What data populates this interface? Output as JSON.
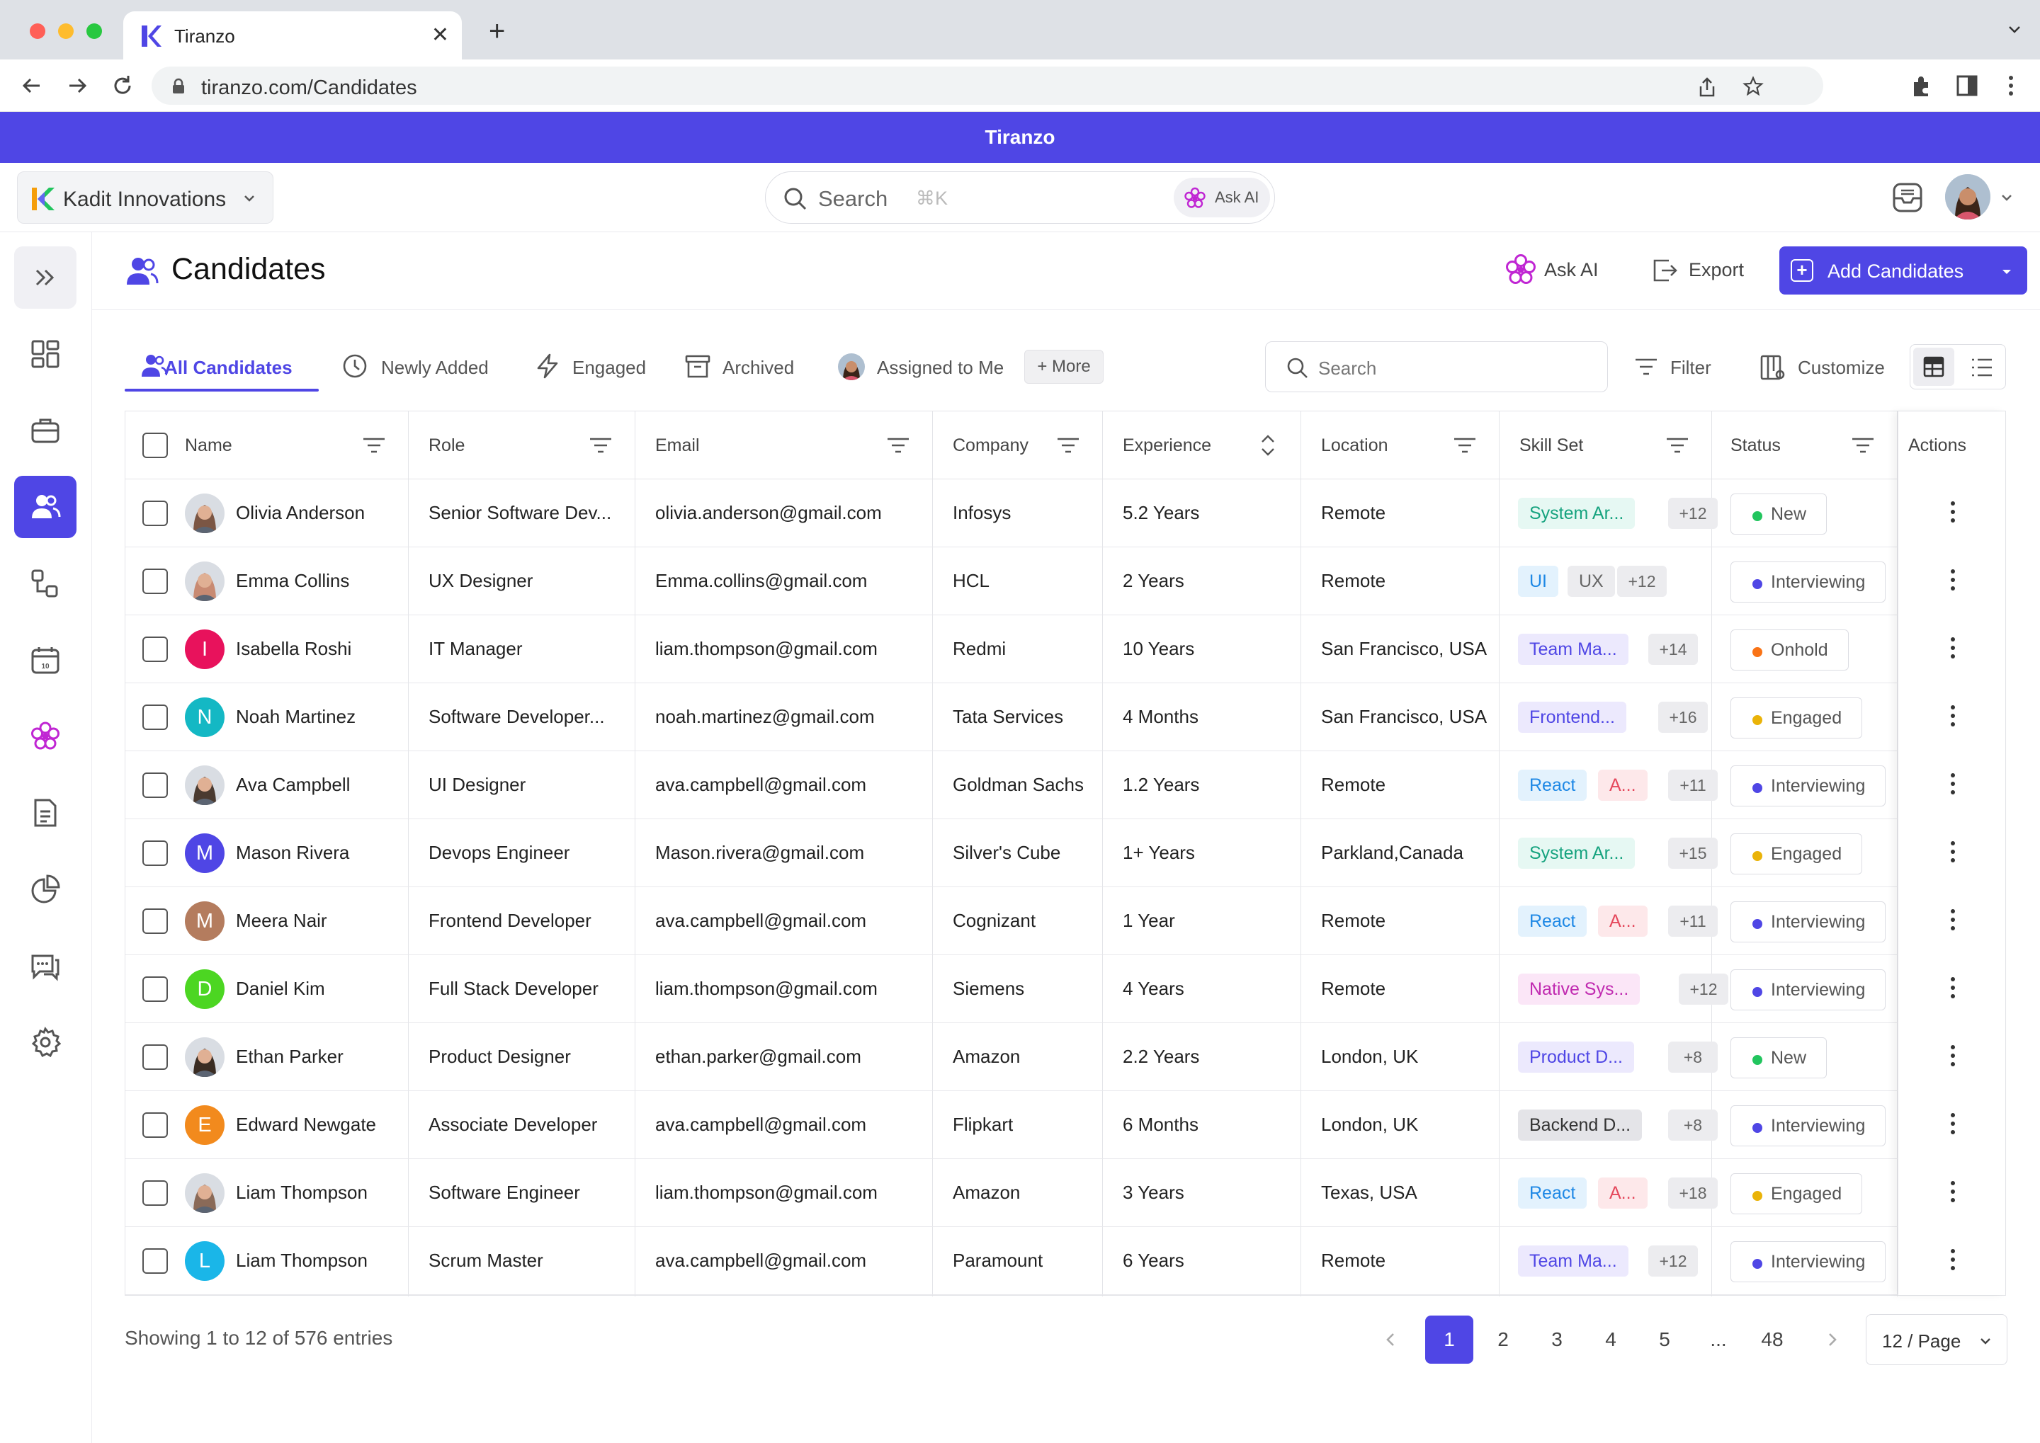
{
  "browser": {
    "tab_title": "Tiranzo",
    "url": "tiranzo.com/Candidates"
  },
  "app": {
    "banner": "Tiranzo",
    "workspace": "Kadit Innovations",
    "search_placeholder": "Search",
    "search_shortcut": "⌘K",
    "ask_ai_pill": "Ask AI"
  },
  "page": {
    "title": "Candidates",
    "ask_ai": "Ask AI",
    "export": "Export",
    "add_candidates": "Add Candidates"
  },
  "tabs": {
    "all": "All Candidates",
    "newly_added": "Newly Added",
    "engaged": "Engaged",
    "archived": "Archived",
    "assigned": "Assigned to Me",
    "more": "+ More"
  },
  "toolbar": {
    "search_placeholder": "Search",
    "filter": "Filter",
    "customize": "Customize"
  },
  "columns": {
    "name": "Name",
    "role": "Role",
    "email": "Email",
    "company": "Company",
    "experience": "Experience",
    "location": "Location",
    "skill_set": "Skill Set",
    "status": "Status",
    "actions": "Actions"
  },
  "colors": {
    "accent": "#4f46e5",
    "status_new": "#22c55e",
    "status_interviewing": "#4f46e5",
    "status_onhold": "#f97316",
    "status_engaged": "#eab308"
  },
  "rows": [
    {
      "name": "Olivia Anderson",
      "initial": "",
      "role": "Senior Software Dev...",
      "email": "olivia.anderson@gmail.com",
      "company": "Infosys",
      "experience": "5.2 Years",
      "location": "Remote",
      "skills": [
        "System Ar..."
      ],
      "skill_more": "+12",
      "status": "New"
    },
    {
      "name": "Emma Collins",
      "initial": "",
      "role": "UX Designer",
      "email": "Emma.collins@gmail.com",
      "company": "HCL",
      "experience": "2 Years",
      "location": "Remote",
      "skills": [
        "UI",
        "UX"
      ],
      "skill_more": "+12",
      "status": "Interviewing"
    },
    {
      "name": "Isabella Roshi",
      "initial": "I",
      "role": "IT Manager",
      "email": "liam.thompson@gmail.com",
      "company": "Redmi",
      "experience": "10 Years",
      "location": "San Francisco, USA",
      "skills": [
        "Team Ma..."
      ],
      "skill_more": "+14",
      "status": "Onhold"
    },
    {
      "name": "Noah Martinez",
      "initial": "N",
      "role": "Software Developer...",
      "email": "noah.martinez@gmail.com",
      "company": "Tata Services",
      "experience": "4 Months",
      "location": "San Francisco, USA",
      "skills": [
        "Frontend..."
      ],
      "skill_more": "+16",
      "status": "Engaged"
    },
    {
      "name": "Ava Campbell",
      "initial": "",
      "role": "UI Designer",
      "email": "ava.campbell@gmail.com",
      "company": "Goldman Sachs",
      "experience": "1.2 Years",
      "location": "Remote",
      "skills": [
        "React",
        "A..."
      ],
      "skill_more": "+11",
      "status": "Interviewing"
    },
    {
      "name": "Mason Rivera",
      "initial": "M",
      "role": "Devops Engineer",
      "email": "Mason.rivera@gmail.com",
      "company": "Silver's Cube",
      "experience": "1+ Years",
      "location": "Parkland,Canada",
      "skills": [
        "System Ar..."
      ],
      "skill_more": "+15",
      "status": "Engaged"
    },
    {
      "name": "Meera Nair",
      "initial": "M",
      "role": "Frontend Developer",
      "email": "ava.campbell@gmail.com",
      "company": "Cognizant",
      "experience": "1 Year",
      "location": "Remote",
      "skills": [
        "React",
        "A..."
      ],
      "skill_more": "+11",
      "status": "Interviewing"
    },
    {
      "name": "Daniel Kim",
      "initial": "D",
      "role": "Full Stack Developer",
      "email": "liam.thompson@gmail.com",
      "company": "Siemens",
      "experience": "4 Years",
      "location": "Remote",
      "skills": [
        "Native Sys..."
      ],
      "skill_more": "+12",
      "status": "Interviewing"
    },
    {
      "name": "Ethan Parker",
      "initial": "",
      "role": "Product Designer",
      "email": "ethan.parker@gmail.com",
      "company": "Amazon",
      "experience": "2.2 Years",
      "location": "London, UK",
      "skills": [
        "Product D..."
      ],
      "skill_more": "+8",
      "status": "New"
    },
    {
      "name": "Edward Newgate",
      "initial": "E",
      "role": "Associate Developer",
      "email": "ava.campbell@gmail.com",
      "company": "Flipkart",
      "experience": "6 Months",
      "location": "London, UK",
      "skills": [
        "Backend D..."
      ],
      "skill_more": "+8",
      "status": "Interviewing"
    },
    {
      "name": "Liam Thompson",
      "initial": "",
      "role": "Software Engineer",
      "email": "liam.thompson@gmail.com",
      "company": "Amazon",
      "experience": "3 Years",
      "location": "Texas, USA",
      "skills": [
        "React",
        "A..."
      ],
      "skill_more": "+18",
      "status": "Engaged"
    },
    {
      "name": "Liam Thompson",
      "initial": "L",
      "role": "Scrum Master",
      "email": "ava.campbell@gmail.com",
      "company": "Paramount",
      "experience": "6 Years",
      "location": "Remote",
      "skills": [
        "Team Ma..."
      ],
      "skill_more": "+12",
      "status": "Interviewing"
    }
  ],
  "pagination": {
    "showing": "Showing 1 to 12 of 576 entries",
    "pages": [
      "1",
      "2",
      "3",
      "4",
      "5",
      "...",
      "48"
    ],
    "current": "1",
    "per_page": "12 / Page"
  }
}
